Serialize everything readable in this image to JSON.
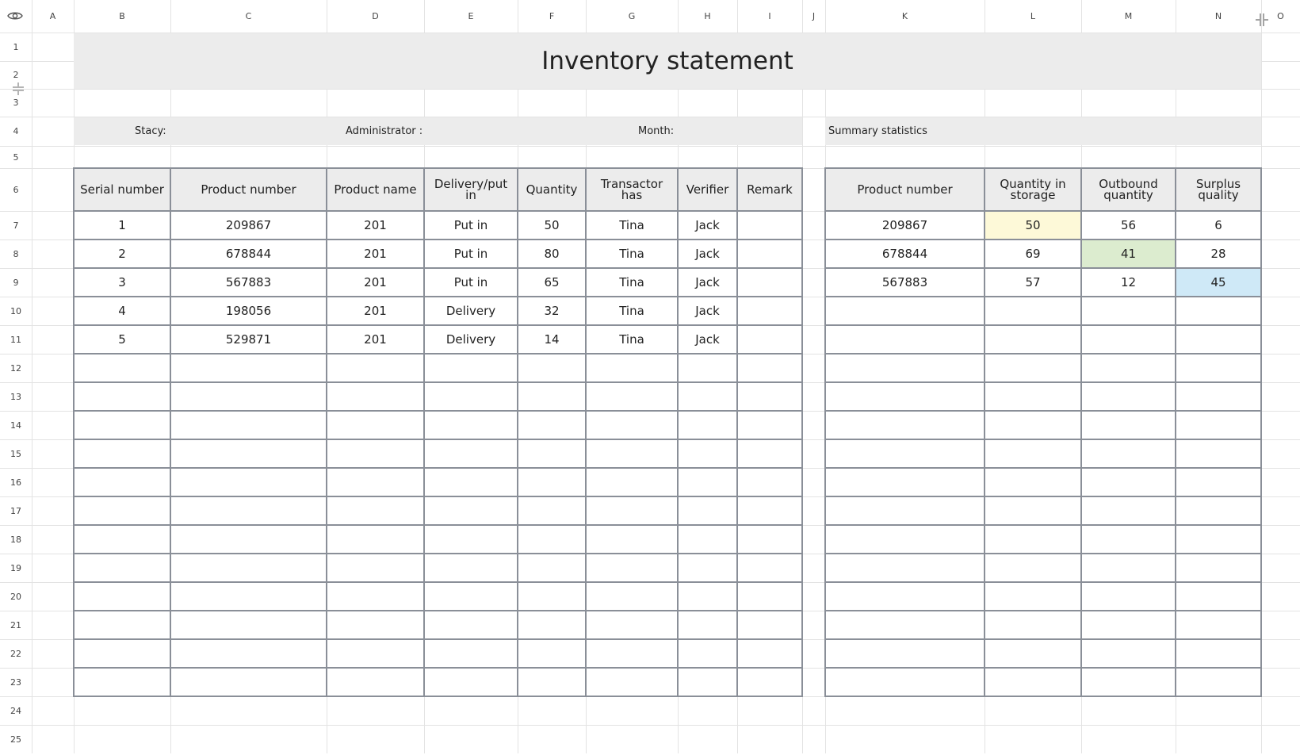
{
  "sheet": {
    "title": "Inventory statement",
    "column_letters": [
      "A",
      "B",
      "C",
      "D",
      "E",
      "F",
      "G",
      "H",
      "I",
      "J",
      "K",
      "L",
      "M",
      "N",
      "O"
    ],
    "row_numbers": [
      "1",
      "2",
      "3",
      "4",
      "5",
      "6",
      "7",
      "8",
      "9",
      "10",
      "11",
      "12",
      "13",
      "14",
      "15",
      "16",
      "17",
      "18",
      "19",
      "20",
      "21",
      "22",
      "23",
      "24",
      "25"
    ],
    "info": {
      "stacy_label": "Stacy:",
      "admin_label": "Administrator :",
      "month_label": "Month:",
      "summary_label": "Summary statistics"
    },
    "main_table": {
      "headers": [
        "Serial number",
        "Product number",
        "Product name",
        "Delivery/put in",
        "Quantity",
        "Transactor has",
        "Verifier",
        "Remark"
      ],
      "rows": [
        [
          "1",
          "209867",
          "201",
          "Put in",
          "50",
          "Tina",
          "Jack",
          ""
        ],
        [
          "2",
          "678844",
          "201",
          "Put in",
          "80",
          "Tina",
          "Jack",
          ""
        ],
        [
          "3",
          "567883",
          "201",
          "Put in",
          "65",
          "Tina",
          "Jack",
          ""
        ],
        [
          "4",
          "198056",
          "201",
          "Delivery",
          "32",
          "Tina",
          "Jack",
          ""
        ],
        [
          "5",
          "529871",
          "201",
          "Delivery",
          "14",
          "Tina",
          "Jack",
          ""
        ]
      ]
    },
    "summary_table": {
      "headers": [
        "Product number",
        "Quantity in storage",
        "Outbound quantity",
        "Surplus quality"
      ],
      "rows": [
        [
          "209867",
          "50",
          "56",
          "6"
        ],
        [
          "678844",
          "69",
          "41",
          "28"
        ],
        [
          "567883",
          "57",
          "12",
          "45"
        ]
      ],
      "highlight_colors": {
        "yellow": "#fdf9d8",
        "green": "#dceccf",
        "blue": "#cfe9f7"
      }
    },
    "colors": {
      "header_fill": "#ececec",
      "grid": "#e3e3e3",
      "border": "#8a8f98"
    },
    "icons": {
      "corner": "eye-icon"
    }
  }
}
